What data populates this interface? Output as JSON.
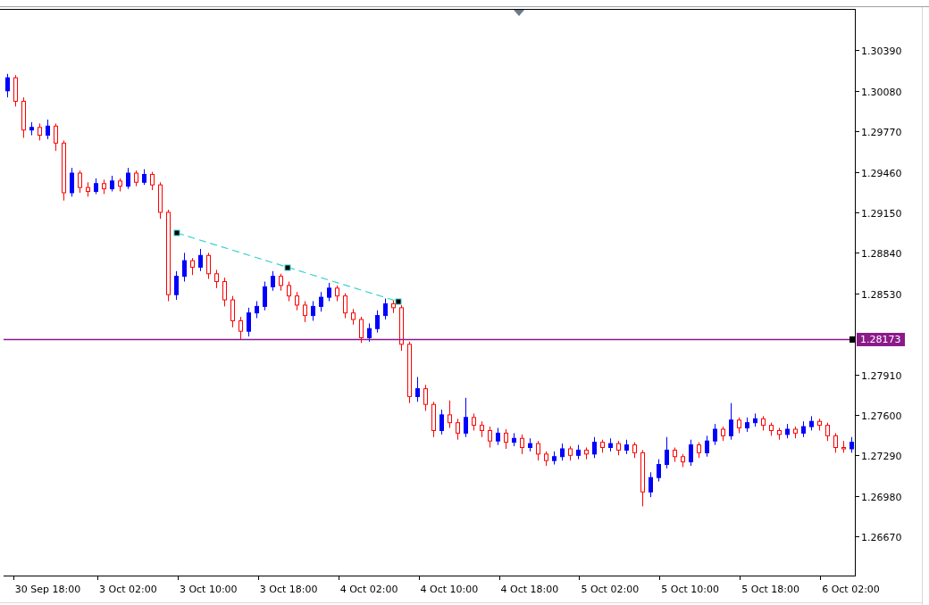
{
  "chart_data": {
    "type": "candlestick",
    "ylim": [
      1.2637,
      1.307
    ],
    "categories": [
      null,
      null,
      null,
      null,
      null,
      "30 Sep 18:00",
      null,
      null,
      null,
      null,
      null,
      null,
      null,
      null,
      null,
      "3 Oct 02:00",
      null,
      null,
      null,
      null,
      null,
      null,
      null,
      null,
      null,
      "3 Oct 10:00",
      null,
      null,
      null,
      null,
      null,
      null,
      null,
      null,
      null,
      "3 Oct 18:00",
      null,
      null,
      null,
      null,
      null,
      null,
      null,
      null,
      null,
      "4 Oct 02:00",
      null,
      null,
      null,
      null,
      null,
      null,
      null,
      null,
      null,
      "4 Oct 10:00",
      null,
      null,
      null,
      null,
      null,
      null,
      null,
      null,
      null,
      "4 Oct 18:00",
      null,
      null,
      null,
      null,
      null,
      null,
      null,
      null,
      null,
      "5 Oct 02:00",
      null,
      null,
      null,
      null,
      null,
      null,
      null,
      null,
      null,
      "5 Oct 10:00",
      null,
      null,
      null,
      null,
      null,
      null,
      null,
      null,
      null,
      "5 Oct 18:00",
      null,
      null,
      null,
      null,
      null,
      null,
      null,
      null,
      null,
      "6 Oct 02:00"
    ],
    "yticks": [
      {
        "value": 1.3039,
        "label": "1.30390"
      },
      {
        "value": 1.3008,
        "label": "1.30080"
      },
      {
        "value": 1.2977,
        "label": "1.29770"
      },
      {
        "value": 1.2946,
        "label": "1.29460"
      },
      {
        "value": 1.2915,
        "label": "1.29150"
      },
      {
        "value": 1.2884,
        "label": "1.28840"
      },
      {
        "value": 1.2853,
        "label": "1.28530"
      },
      {
        "value": 1.2791,
        "label": "1.27910"
      },
      {
        "value": 1.276,
        "label": "1.27600"
      },
      {
        "value": 1.2729,
        "label": "1.27290"
      },
      {
        "value": 1.2698,
        "label": "1.26980"
      },
      {
        "value": 1.2667,
        "label": "1.26670"
      }
    ],
    "ohlc": [
      [
        1.3008,
        1.3021,
        1.3003,
        1.3018
      ],
      [
        1.3018,
        1.302,
        1.2996,
        1.3
      ],
      [
        1.3,
        1.3003,
        1.2972,
        1.2978
      ],
      [
        1.2978,
        1.2984,
        1.2974,
        1.298
      ],
      [
        1.298,
        1.2983,
        1.297,
        1.2974
      ],
      [
        1.2974,
        1.2986,
        1.2971,
        1.2981
      ],
      [
        1.2981,
        1.2983,
        1.2962,
        1.2968
      ],
      [
        1.2968,
        1.297,
        1.2924,
        1.293
      ],
      [
        1.293,
        1.2949,
        1.2927,
        1.2945
      ],
      [
        1.2945,
        1.2947,
        1.293,
        1.2934
      ],
      [
        1.2934,
        1.2938,
        1.2927,
        1.2931
      ],
      [
        1.2931,
        1.2941,
        1.2929,
        1.2937
      ],
      [
        1.2937,
        1.294,
        1.2929,
        1.2933
      ],
      [
        1.2933,
        1.2943,
        1.2931,
        1.2939
      ],
      [
        1.2939,
        1.2941,
        1.2931,
        1.2935
      ],
      [
        1.2935,
        1.2949,
        1.2933,
        1.2945
      ],
      [
        1.2945,
        1.2947,
        1.2935,
        1.2938
      ],
      [
        1.2938,
        1.2948,
        1.2936,
        1.2944
      ],
      [
        1.2944,
        1.2946,
        1.2932,
        1.2936
      ],
      [
        1.2936,
        1.2938,
        1.291,
        1.2915
      ],
      [
        1.2915,
        1.2917,
        1.2847,
        1.2852
      ],
      [
        1.2852,
        1.287,
        1.2848,
        1.2866
      ],
      [
        1.2866,
        1.2884,
        1.2862,
        1.2878
      ],
      [
        1.2878,
        1.288,
        1.2867,
        1.2873
      ],
      [
        1.2873,
        1.2887,
        1.287,
        1.2882
      ],
      [
        1.2882,
        1.2884,
        1.2864,
        1.2868
      ],
      [
        1.2868,
        1.2871,
        1.2857,
        1.2862
      ],
      [
        1.2862,
        1.2865,
        1.2843,
        1.2848
      ],
      [
        1.2848,
        1.2851,
        1.2827,
        1.2832
      ],
      [
        1.2832,
        1.2835,
        1.2818,
        1.2824
      ],
      [
        1.2824,
        1.2842,
        1.282,
        1.2838
      ],
      [
        1.2838,
        1.2847,
        1.2834,
        1.2843
      ],
      [
        1.2843,
        1.2862,
        1.284,
        1.2858
      ],
      [
        1.2858,
        1.287,
        1.2855,
        1.2866
      ],
      [
        1.2866,
        1.2868,
        1.2855,
        1.2859
      ],
      [
        1.2859,
        1.2862,
        1.2847,
        1.2851
      ],
      [
        1.2851,
        1.2854,
        1.284,
        1.2844
      ],
      [
        1.2844,
        1.2847,
        1.2831,
        1.2836
      ],
      [
        1.2836,
        1.2847,
        1.2832,
        1.2843
      ],
      [
        1.2843,
        1.2854,
        1.2839,
        1.285
      ],
      [
        1.285,
        1.2861,
        1.2847,
        1.2857
      ],
      [
        1.2857,
        1.2859,
        1.2847,
        1.2851
      ],
      [
        1.2851,
        1.2853,
        1.2834,
        1.2838
      ],
      [
        1.2838,
        1.2841,
        1.2829,
        1.2833
      ],
      [
        1.2833,
        1.2835,
        1.2815,
        1.2819
      ],
      [
        1.2819,
        1.283,
        1.2816,
        1.2826
      ],
      [
        1.2826,
        1.284,
        1.2823,
        1.2836
      ],
      [
        1.2836,
        1.2849,
        1.2833,
        1.2845
      ],
      [
        1.2845,
        1.2848,
        1.2838,
        1.2842
      ],
      [
        1.2842,
        1.2844,
        1.2809,
        1.2814
      ],
      [
        1.2814,
        1.2816,
        1.2769,
        1.2774
      ],
      [
        1.2774,
        1.2789,
        1.277,
        1.278
      ],
      [
        1.278,
        1.2783,
        1.2763,
        1.2768
      ],
      [
        1.2768,
        1.277,
        1.2743,
        1.2748
      ],
      [
        1.2748,
        1.2764,
        1.2745,
        1.276
      ],
      [
        1.276,
        1.2771,
        1.275,
        1.2754
      ],
      [
        1.2754,
        1.2757,
        1.2741,
        1.2746
      ],
      [
        1.2746,
        1.2773,
        1.2743,
        1.2758
      ],
      [
        1.2758,
        1.2761,
        1.2748,
        1.2752
      ],
      [
        1.2752,
        1.2755,
        1.2743,
        1.2748
      ],
      [
        1.2748,
        1.2751,
        1.2735,
        1.274
      ],
      [
        1.274,
        1.275,
        1.2737,
        1.2746
      ],
      [
        1.2746,
        1.2749,
        1.2734,
        1.2739
      ],
      [
        1.2739,
        1.2746,
        1.2736,
        1.2742
      ],
      [
        1.2742,
        1.2745,
        1.273,
        1.2735
      ],
      [
        1.2735,
        1.2742,
        1.2732,
        1.2738
      ],
      [
        1.2738,
        1.274,
        1.2725,
        1.273
      ],
      [
        1.273,
        1.2732,
        1.2721,
        1.2725
      ],
      [
        1.2725,
        1.2732,
        1.2722,
        1.2728
      ],
      [
        1.2728,
        1.2738,
        1.2725,
        1.2734
      ],
      [
        1.2734,
        1.2736,
        1.2725,
        1.2729
      ],
      [
        1.2729,
        1.2737,
        1.2726,
        1.2733
      ],
      [
        1.2733,
        1.2735,
        1.2726,
        1.273
      ],
      [
        1.273,
        1.2743,
        1.2727,
        1.2739
      ],
      [
        1.2739,
        1.2741,
        1.2731,
        1.2735
      ],
      [
        1.2735,
        1.2742,
        1.2732,
        1.2738
      ],
      [
        1.2738,
        1.274,
        1.2729,
        1.2733
      ],
      [
        1.2733,
        1.2741,
        1.273,
        1.2737
      ],
      [
        1.2737,
        1.2739,
        1.2727,
        1.2731
      ],
      [
        1.2731,
        1.2733,
        1.269,
        1.2701
      ],
      [
        1.2701,
        1.2716,
        1.2697,
        1.2712
      ],
      [
        1.2712,
        1.2726,
        1.2709,
        1.2722
      ],
      [
        1.2722,
        1.2743,
        1.2719,
        1.2733
      ],
      [
        1.2733,
        1.2735,
        1.2724,
        1.2728
      ],
      [
        1.2728,
        1.273,
        1.272,
        1.2724
      ],
      [
        1.2724,
        1.2741,
        1.2721,
        1.2737
      ],
      [
        1.2737,
        1.2739,
        1.2727,
        1.2731
      ],
      [
        1.2731,
        1.2744,
        1.2728,
        1.274
      ],
      [
        1.274,
        1.2753,
        1.2737,
        1.2749
      ],
      [
        1.2749,
        1.2751,
        1.274,
        1.2744
      ],
      [
        1.2744,
        1.2769,
        1.2741,
        1.2756
      ],
      [
        1.2756,
        1.2758,
        1.2746,
        1.275
      ],
      [
        1.275,
        1.2758,
        1.2747,
        1.2754
      ],
      [
        1.2754,
        1.2761,
        1.2751,
        1.2757
      ],
      [
        1.2757,
        1.2759,
        1.2748,
        1.2752
      ],
      [
        1.2752,
        1.2754,
        1.2744,
        1.2748
      ],
      [
        1.2748,
        1.275,
        1.2741,
        1.2745
      ],
      [
        1.2745,
        1.2753,
        1.2742,
        1.2749
      ],
      [
        1.2749,
        1.2751,
        1.2742,
        1.2746
      ],
      [
        1.2746,
        1.2755,
        1.2743,
        1.2751
      ],
      [
        1.2751,
        1.2759,
        1.2748,
        1.2755
      ],
      [
        1.2755,
        1.2757,
        1.2748,
        1.2752
      ],
      [
        1.2752,
        1.2754,
        1.274,
        1.2744
      ],
      [
        1.2744,
        1.2746,
        1.2731,
        1.2735
      ],
      [
        1.2735,
        1.274,
        1.2731,
        1.2734
      ],
      [
        1.2734,
        1.2743,
        1.2731,
        1.2739
      ]
    ]
  },
  "price_line": {
    "label": "1.28173",
    "color": "#8b1a8b"
  }
}
